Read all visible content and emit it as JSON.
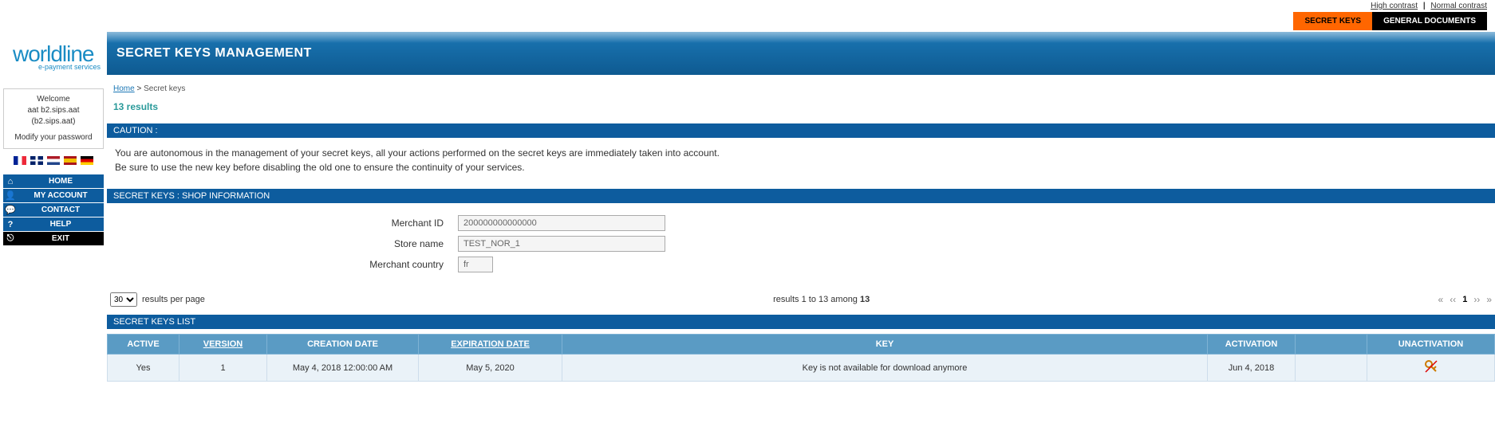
{
  "top_links": {
    "high_contrast": "High contrast",
    "normal_contrast": "Normal contrast"
  },
  "tabs": {
    "secret_keys": "SECRET KEYS",
    "general_documents": "GENERAL DOCUMENTS"
  },
  "logo": {
    "main": "worldline",
    "sub": "e-payment services"
  },
  "page_title": "SECRET KEYS MANAGEMENT",
  "breadcrumb": {
    "home": "Home",
    "current": "Secret keys"
  },
  "results_summary": "13 results",
  "caution": {
    "header": "CAUTION  :",
    "line1": "You are autonomous in the management of your secret keys, all your actions performed on the secret keys are immediately taken into account.",
    "line2": "Be sure to use the new key before disabling the old one to ensure the continuity of your services."
  },
  "shop_info": {
    "header": "SECRET KEYS  :  SHOP INFORMATION",
    "merchant_id_label": "Merchant ID",
    "merchant_id": "200000000000000",
    "store_name_label": "Store name",
    "store_name": "TEST_NOR_1",
    "merchant_country_label": "Merchant country",
    "merchant_country": "fr"
  },
  "pager": {
    "per_page_value": "30",
    "per_page_label": "results per page",
    "range_prefix": "results 1 to 13 among ",
    "total": "13",
    "current_page": "1"
  },
  "list_header": "SECRET KEYS LIST",
  "columns": {
    "active": "ACTIVE",
    "version": "VERSION",
    "creation": "CREATION DATE",
    "expiration": "EXPIRATION DATE",
    "key": "KEY",
    "activation": "ACTIVATION",
    "unactivation": "UNACTIVATION"
  },
  "rows": [
    {
      "active": "Yes",
      "version": "1",
      "creation": "May 4, 2018 12:00:00 AM",
      "expiration": "May 5, 2020",
      "key": "Key is not available for download anymore",
      "activation": "Jun 4, 2018"
    }
  ],
  "user": {
    "welcome": "Welcome",
    "line1": "aat b2.sips.aat",
    "line2": "(b2.sips.aat)",
    "modify": "Modify your password"
  },
  "nav": {
    "home": "HOME",
    "my_account": "MY ACCOUNT",
    "contact": "CONTACT",
    "help": "HELP",
    "exit": "EXIT"
  }
}
